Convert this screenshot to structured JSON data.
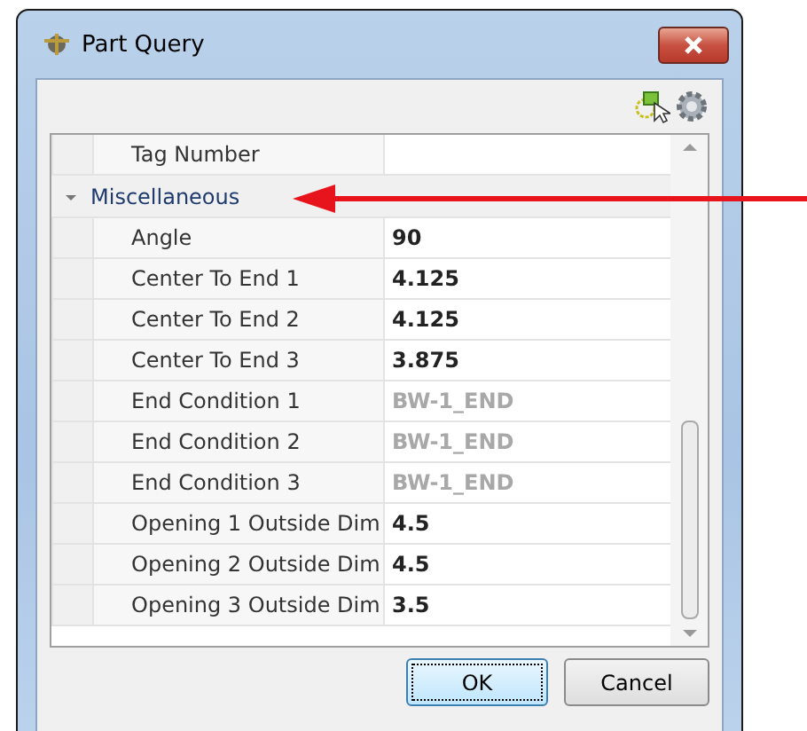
{
  "window": {
    "title": "Part Query"
  },
  "properties": [
    {
      "kind": "property",
      "label": "Tag Number"
    },
    {
      "kind": "category",
      "label": "Miscellaneous",
      "expanded": true
    },
    {
      "kind": "property",
      "label": "Angle",
      "value": "90",
      "disabled": false
    },
    {
      "kind": "property",
      "label": "Center To End 1",
      "value": "4.125",
      "disabled": false
    },
    {
      "kind": "property",
      "label": "Center To End 2",
      "value": "4.125",
      "disabled": false
    },
    {
      "kind": "property",
      "label": "Center To End 3",
      "value": "3.875",
      "disabled": false
    },
    {
      "kind": "property",
      "label": "End Condition 1",
      "value": "BW-1_END",
      "disabled": true
    },
    {
      "kind": "property",
      "label": "End Condition 2",
      "value": "BW-1_END",
      "disabled": true
    },
    {
      "kind": "property",
      "label": "End Condition 3",
      "value": "BW-1_END",
      "disabled": true
    },
    {
      "kind": "property",
      "label": "Opening 1 Outside Dim",
      "value": "4.5",
      "disabled": false
    },
    {
      "kind": "property",
      "label": "Opening 2 Outside Dim",
      "value": "4.5",
      "disabled": false
    },
    {
      "kind": "property",
      "label": "Opening 3 Outside Dim",
      "value": "3.5",
      "disabled": false
    }
  ],
  "buttons": [
    {
      "label": "OK",
      "selected": true
    },
    {
      "label": "Cancel",
      "selected": false
    }
  ]
}
